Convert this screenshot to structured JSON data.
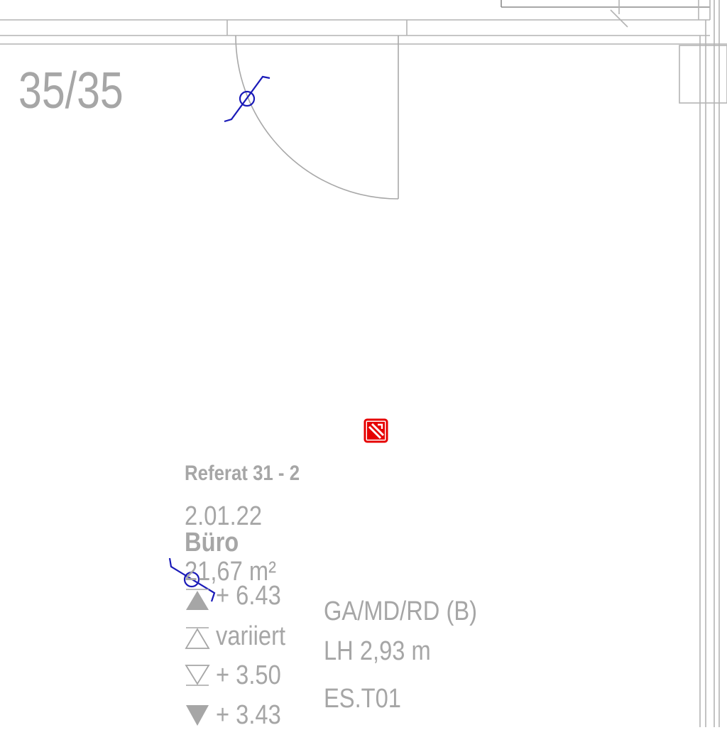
{
  "plan": {
    "column_label": "35/35",
    "department": "Referat 31 -  2",
    "room_number": "2.01.22",
    "room_name": "Büro",
    "room_area": "21,67 m²",
    "levels": [
      {
        "symbol": "filled-up-triangle-icon",
        "value": "+ 6.43"
      },
      {
        "symbol": "outline-up-triangle-icon",
        "value": "variiert"
      },
      {
        "symbol": "outline-down-triangle-icon",
        "value": "+ 3.50"
      },
      {
        "symbol": "filled-down-triangle-icon",
        "value": "+ 3.43"
      }
    ],
    "finish_code": "GA/MD/RD (B)",
    "ceiling_height": "LH 2,93 m",
    "element_code": "ES.T01"
  },
  "colors": {
    "walls": "#b4b4b4",
    "text": "#a6a6a6",
    "sensor": "#1a1ab8",
    "fire_symbol": "#e60000"
  }
}
